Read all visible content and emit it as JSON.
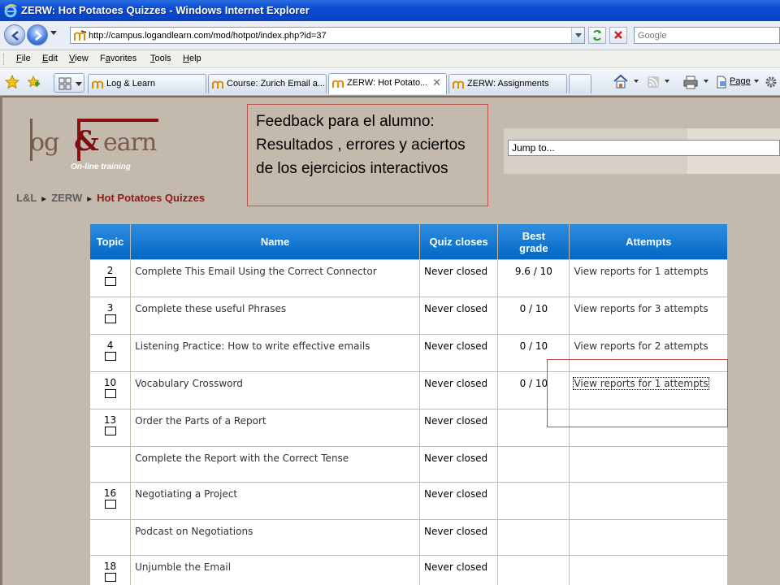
{
  "window": {
    "title": "ZERW: Hot Potatoes Quizzes - Windows Internet Explorer"
  },
  "address": {
    "url": "http://campus.logandlearn.com/mod/hotpot/index.php?id=37",
    "search_placeholder": "Google"
  },
  "menu": {
    "items": [
      {
        "ul": "F",
        "rest": "ile"
      },
      {
        "ul": "E",
        "rest": "dit"
      },
      {
        "ul": "V",
        "rest": "iew"
      },
      {
        "pre": "F",
        "ul": "a",
        "rest": "vorites"
      },
      {
        "ul": "T",
        "rest": "ools"
      },
      {
        "ul": "H",
        "rest": "elp"
      }
    ]
  },
  "tabs": [
    {
      "label": "Log & Learn"
    },
    {
      "label": "Course: Zurich Email a..."
    },
    {
      "label": "ZERW: Hot Potato..."
    },
    {
      "label": "ZERW: Assignments"
    }
  ],
  "toolbar": {
    "page_label": "Page"
  },
  "header": {
    "logo_tagline": "On-line training",
    "jump_to": "Jump to..."
  },
  "callout": {
    "text": "Feedback para el alumno: Resultados , errores y aciertos de los ejercicios interactivos"
  },
  "breadcrumb": {
    "items": [
      "L&L",
      "ZERW",
      "Hot Potatoes Quizzes"
    ],
    "separator": "►"
  },
  "table": {
    "headers": {
      "topic": "Topic",
      "name": "Name",
      "closes": "Quiz closes",
      "grade": "Best grade",
      "attempts": "Attempts"
    },
    "rows": [
      {
        "topic": "2",
        "name": "Complete This Email Using the Correct Connector",
        "closes": "Never closed",
        "grade": "9.6 / 10",
        "attempts": "View reports for 1 attempts"
      },
      {
        "topic": "3",
        "name": "Complete these useful Phrases",
        "closes": "Never closed",
        "grade": "0 / 10",
        "attempts": "View reports for 3 attempts"
      },
      {
        "topic": "4",
        "name": "Listening Practice: How to write effective emails",
        "closes": "Never closed",
        "grade": "0 / 10",
        "attempts": "View reports for 2 attempts"
      },
      {
        "topic": "10",
        "name": "Vocabulary Crossword",
        "closes": "Never closed",
        "grade": "0 / 10",
        "attempts": "View reports for 1 attempts"
      },
      {
        "topic": "13",
        "name": "Order the Parts of a Report",
        "closes": "Never closed",
        "grade": "",
        "attempts": ""
      },
      {
        "topic": "",
        "name": "Complete the Report with the Correct Tense",
        "closes": "Never closed",
        "grade": "",
        "attempts": ""
      },
      {
        "topic": "16",
        "name": "Negotiating a Project",
        "closes": "Never closed",
        "grade": "",
        "attempts": ""
      },
      {
        "topic": "",
        "name": "Podcast on Negotiations",
        "closes": "Never closed",
        "grade": "",
        "attempts": ""
      },
      {
        "topic": "18",
        "name": "Unjumble the Email",
        "closes": "Never closed",
        "grade": "",
        "attempts": ""
      }
    ]
  },
  "colors": {
    "header_blue": "#0a6bc6",
    "callout_border": "#c0504d",
    "page_bg": "#c4b9ad"
  }
}
